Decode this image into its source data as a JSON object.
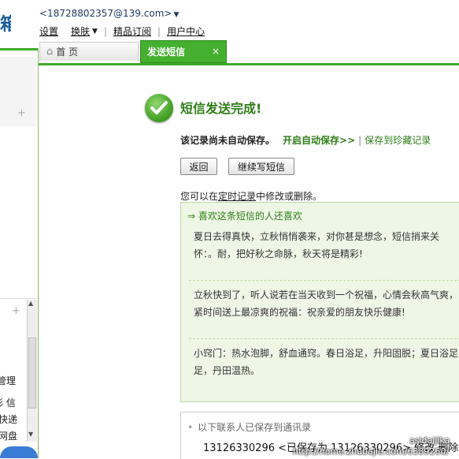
{
  "header": {
    "account_email": "<18728802357@139.com>",
    "nav": {
      "settings": "设置",
      "skin": "换肤",
      "premium": "精品订阅",
      "user_center": "用户中心"
    }
  },
  "tabs": {
    "home": "首 页",
    "send_sms": "发送短信",
    "close": "×"
  },
  "sidebar": {
    "plus1": "+",
    "plus2": "+",
    "items": [
      "管理",
      "彩 信",
      "快递",
      "网盘"
    ]
  },
  "result": {
    "title": "短信发送完成!",
    "not_saved": "该记录尚未自动保存。",
    "enable_autosave": "开启自动保存>>",
    "separator": "|",
    "save_to_fav": "保存到珍藏记录",
    "back_button": "返回",
    "continue_button": "继续写短信",
    "hint_prefix": "您可以在",
    "hint_link": "定时记录",
    "hint_suffix": "中修改或删除。"
  },
  "recommend": {
    "heading": "⇒ 喜欢这条短信的人还喜欢",
    "items": [
      "夏日去得真快，立秋悄悄袭来，对你甚是想念，短信捎来关怀：。耐，把好秋之命脉，秋天将是精彩!",
      "立秋快到了，听人说若在当天收到一个祝福，心情会秋高气爽，紧时间送上最凉爽的祝福：祝亲爱的朋友快乐健康!",
      "小窍门：热水泡脚，舒血通窍。春日浴足，升阳固脱；夏日浴足足，丹田温热。"
    ]
  },
  "saved_contacts": {
    "heading": "以下联系人已保存到通讯录",
    "phone": "13126330296",
    "saved_as": "<已保存为 13126330296>",
    "action_edit": "修改",
    "action_delete": "删除"
  },
  "watermark": {
    "user": "asidaijika",
    "url": "http://home.zhubajie.com/6389260/"
  },
  "colors": {
    "accent_green": "#3faa2a",
    "title_green": "#2e7d17",
    "panel_bg": "#eef6e6"
  }
}
